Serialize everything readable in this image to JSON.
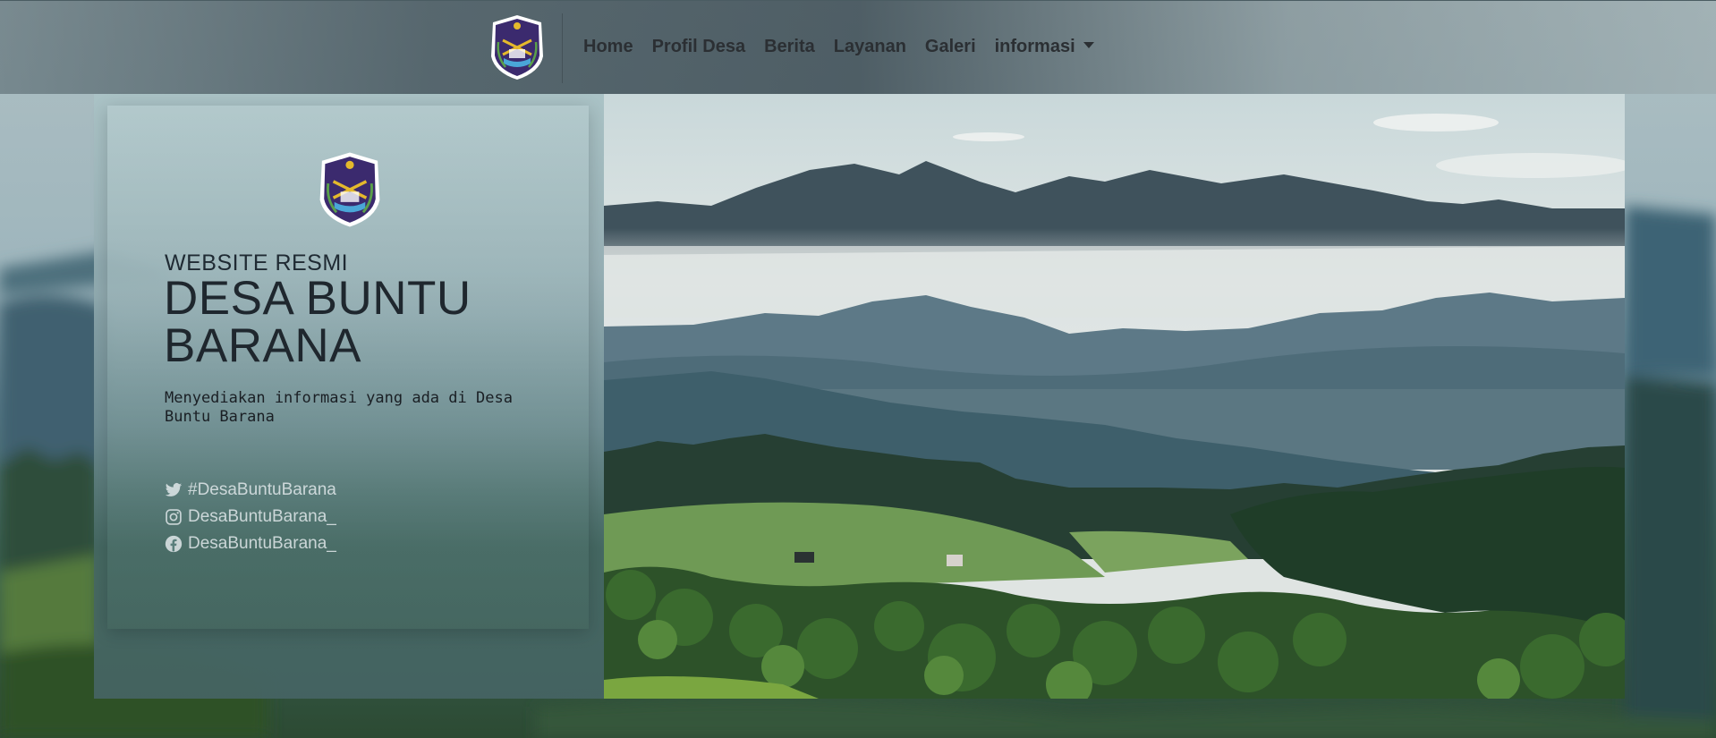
{
  "nav": {
    "logo_icon": "village-emblem-icon",
    "items": [
      {
        "label": "Home"
      },
      {
        "label": "Profil Desa"
      },
      {
        "label": "Berita"
      },
      {
        "label": "Layanan"
      },
      {
        "label": "Galeri"
      },
      {
        "label": "informasi",
        "has_dropdown": true
      }
    ]
  },
  "hero": {
    "logo_icon": "village-emblem-icon",
    "subtitle": "WEBSITE RESMI",
    "title": "DESA BUNTU BARANA",
    "description": "Menyediakan informasi yang ada di Desa Buntu Barana",
    "socials": [
      {
        "icon": "twitter-icon",
        "label": "#DesaBuntuBarana"
      },
      {
        "icon": "instagram-icon",
        "label": "DesaBuntuBarana_"
      },
      {
        "icon": "facebook-icon",
        "label": "DesaBuntuBarana_"
      }
    ],
    "image_icon": "mountain-landscape-photo"
  },
  "colors": {
    "nav_text": "#2b2f33",
    "title_text": "#1f272e",
    "emblem_purple": "#3b2a6e",
    "emblem_gold": "#e4b92c"
  }
}
